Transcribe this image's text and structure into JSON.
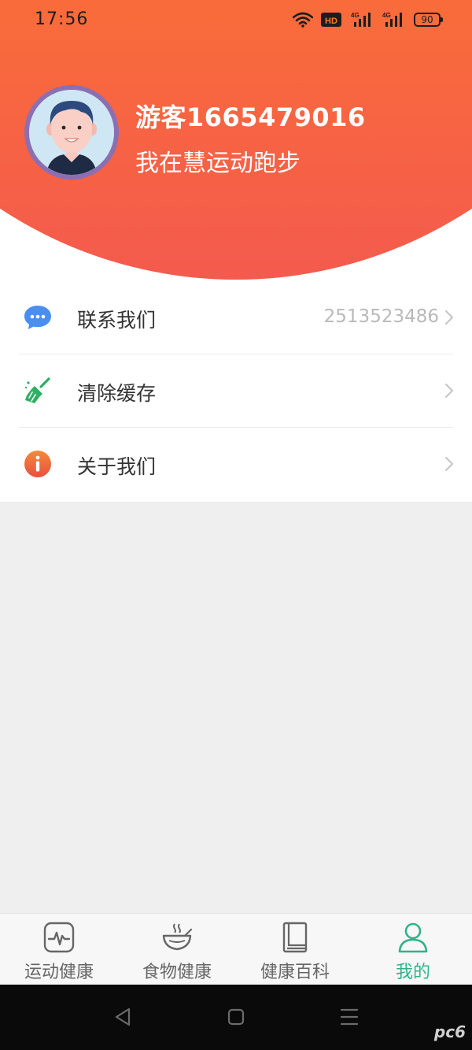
{
  "status_bar": {
    "time": "17:56",
    "network_labels": [
      "HD",
      "4G",
      "4G"
    ],
    "battery": "90"
  },
  "profile": {
    "name": "游客1665479016",
    "subtitle": "我在慧运动跑步",
    "avatar_icon": "avatar-boy-icon"
  },
  "menu": [
    {
      "label": "联系我们",
      "value": "2513523486",
      "icon": "chat-bubble-icon"
    },
    {
      "label": "清除缓存",
      "value": "",
      "icon": "broom-icon"
    },
    {
      "label": "关于我们",
      "value": "",
      "icon": "info-icon"
    }
  ],
  "tabs": [
    {
      "label": "运动健康",
      "icon": "heartbeat-monitor-icon",
      "active": false
    },
    {
      "label": "食物健康",
      "icon": "bowl-icon",
      "active": false
    },
    {
      "label": "健康百科",
      "icon": "book-icon",
      "active": false
    },
    {
      "label": "我的",
      "icon": "person-icon",
      "active": true
    }
  ],
  "watermark": "pc6",
  "colors": {
    "header_gradient_top": "#fb7c2a",
    "header_gradient_bottom": "#f45a4e",
    "active_tab": "#2fb38a",
    "menu_label": "#333333",
    "menu_value": "#b9b9b9",
    "chat_icon": "#4a8ff0",
    "broom_icon": "#2cae63",
    "info_icon": "#f0663a"
  }
}
